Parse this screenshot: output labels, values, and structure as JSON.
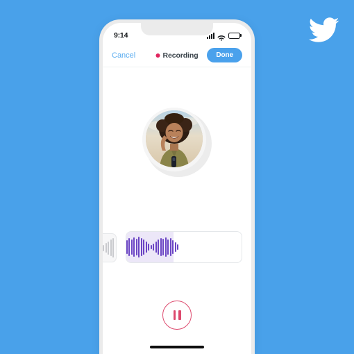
{
  "brand": {
    "logo_icon": "twitter-bird-icon",
    "background_color": "#49a1ea",
    "logo_color": "#ffffff"
  },
  "phone": {
    "frame_color": "#ebebeb",
    "screen_color": "#ffffff"
  },
  "status_bar": {
    "time": "9:14",
    "signal_icon": "cellular-signal-icon",
    "wifi_icon": "wifi-icon",
    "battery_icon": "battery-full-icon"
  },
  "nav_bar": {
    "cancel_label": "Cancel",
    "cancel_color": "#5badf0",
    "recording_label": "Recording",
    "recording_dot_color": "#e0245e",
    "done_label": "Done",
    "done_bg_color": "#4aa1ec"
  },
  "avatar": {
    "icon": "user-avatar-photo",
    "alt": "Smiling person with curly afro hair outdoors"
  },
  "waveform": {
    "active_bg_color": "#ece7f8",
    "active_bar_color": "#6b45c4",
    "previous_bar_color": "#c9cace",
    "active_bar_heights": [
      6,
      12,
      20,
      26,
      22,
      28,
      24,
      30,
      26,
      22,
      16,
      10,
      6,
      10,
      16,
      22,
      26,
      24,
      28,
      22,
      26,
      20,
      14,
      8
    ],
    "previous_bar_heights": [
      5,
      9,
      14,
      19,
      24,
      28
    ]
  },
  "controls": {
    "pause_label": "Pause",
    "pause_icon": "pause-icon",
    "pause_color": "#dd4a6e"
  },
  "home_indicator": {
    "color": "#0e0e0e"
  }
}
